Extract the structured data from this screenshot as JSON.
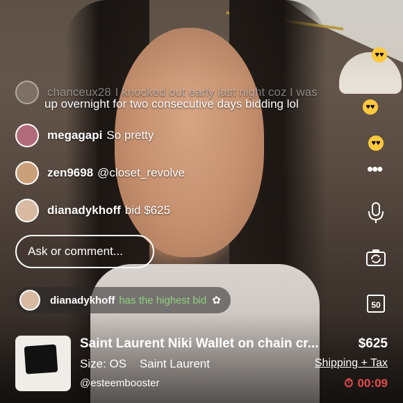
{
  "comments": [
    {
      "user": "chanceux28",
      "text": "I knocked out early last night coz I was"
    },
    {
      "user": "",
      "text": "up overnight for two consecutive days bidding lol"
    },
    {
      "user": "megagapi",
      "text": "So pretty"
    },
    {
      "user": "zen9698",
      "text": "@closet_revolve"
    },
    {
      "user": "dianadykhoff",
      "text": "bid $625"
    }
  ],
  "input": {
    "placeholder": "Ask or comment..."
  },
  "highest_bid": {
    "user": "dianadykhoff",
    "text": "has the highest bid"
  },
  "product": {
    "title": "Saint Laurent Niki Wallet on chain cr...",
    "price": "$625",
    "size": "Size: OS",
    "brand": "Saint Laurent",
    "shipping": "Shipping + Tax",
    "seller": "@esteembooster",
    "timer": "00:09"
  },
  "side": {
    "badge": "50"
  },
  "colors": {
    "highlight": "#8fd17a",
    "timer": "#e64b4b"
  }
}
